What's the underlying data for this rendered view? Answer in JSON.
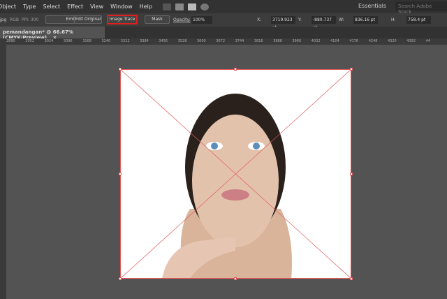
{
  "menu": [
    "Object",
    "Type",
    "Select",
    "Effect",
    "View",
    "Window",
    "Help"
  ],
  "workspace": "Essentials",
  "search_placeholder": "Search Adobe Stock",
  "control": {
    "file": "jpg",
    "mode": "RGB",
    "ppi": "PPI: 300",
    "embed": "Embed",
    "edit_original": "Edit Original",
    "image_trace": "Image Trace",
    "mask": "Mask",
    "opacity_label": "Opacity:",
    "opacity": "100%",
    "x_label": "X:",
    "x": "3719.923 pt",
    "y_label": "Y:",
    "y": "-880.737 pt",
    "w_label": "W:",
    "w": "836.16 pt",
    "h_label": "H:",
    "h": "758.4 pt"
  },
  "tab": {
    "title": "pemandangan* @ 66.67% (CMYK/Preview)",
    "close": "×"
  },
  "ruler": [
    "2880",
    "2952",
    "3024",
    "3096",
    "3168",
    "3240",
    "3312",
    "3384",
    "3456",
    "3528",
    "3600",
    "3672",
    "3744",
    "3816",
    "3888",
    "3960",
    "4032",
    "4104",
    "4176",
    "4248",
    "4320",
    "4392",
    "44"
  ],
  "colors": {
    "highlight": "#e0201f",
    "selection": "#e05a5a"
  }
}
